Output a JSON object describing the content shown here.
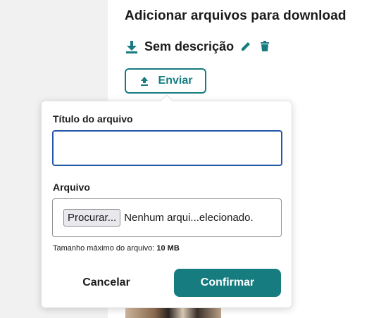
{
  "section": {
    "heading": "Adicionar arquivos para download"
  },
  "file": {
    "name": "Sem descrição",
    "download_icon": "download-icon",
    "edit_icon": "pencil-icon",
    "delete_icon": "trash-icon"
  },
  "upload_button": {
    "label": "Enviar",
    "icon": "upload-icon"
  },
  "form": {
    "title_label": "Título do arquivo",
    "title_value": "",
    "file_label": "Arquivo",
    "browse_label": "Procurar...",
    "file_status": "Nenhum arqui...elecionado.",
    "size_prefix": "Tamanho máximo do arquivo:",
    "size_value": "10 MB",
    "cancel_label": "Cancelar",
    "confirm_label": "Confirmar"
  },
  "colors": {
    "accent": "#167c80",
    "focus": "#2257a8"
  }
}
